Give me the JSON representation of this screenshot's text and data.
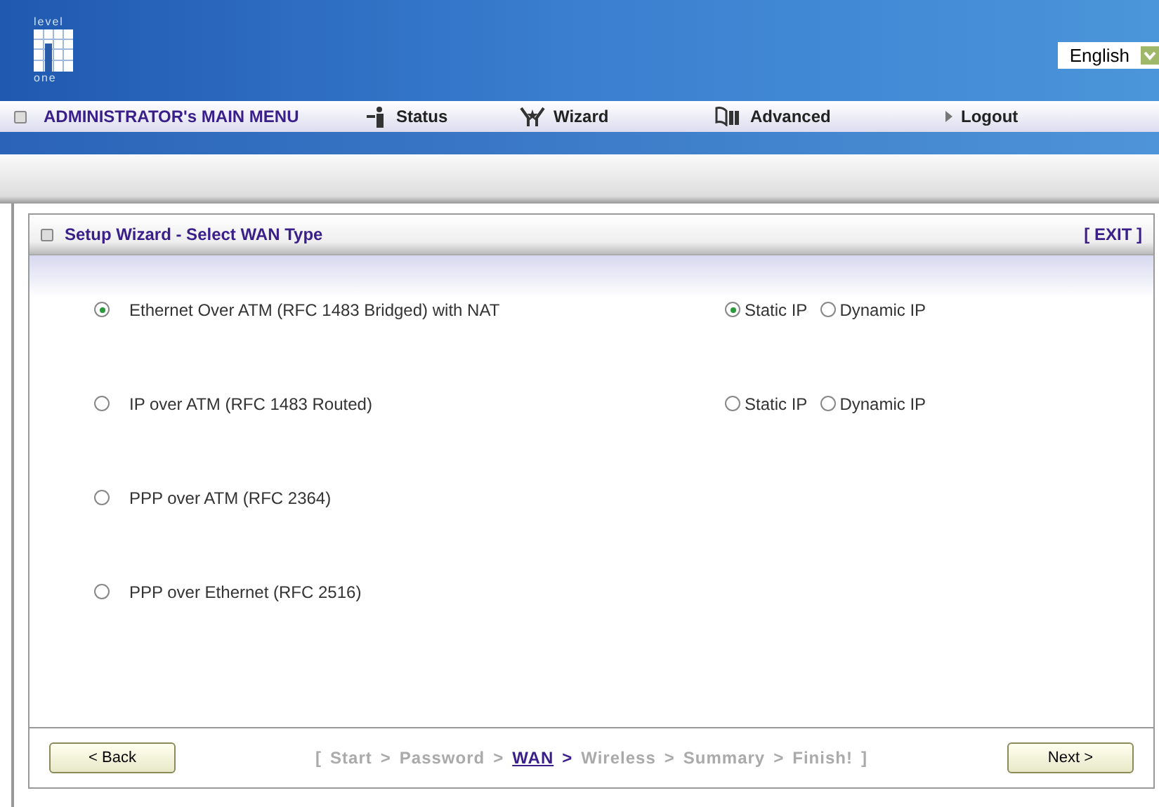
{
  "logo": {
    "top": "level",
    "bottom": "one"
  },
  "language": {
    "value": "English"
  },
  "menu": [
    {
      "label": "ADMINISTRATOR's MAIN MENU",
      "kind": "title"
    },
    {
      "label": "Status",
      "kind": "status"
    },
    {
      "label": "Wizard",
      "kind": "wizard"
    },
    {
      "label": "Advanced",
      "kind": "advanced"
    },
    {
      "label": "Logout",
      "kind": "logout"
    }
  ],
  "panel": {
    "title": "Setup Wizard - Select WAN Type",
    "exit": "[ EXIT ]"
  },
  "wan_types": [
    {
      "label": "Ethernet Over ATM (RFC 1483 Bridged) with NAT",
      "selected": true,
      "ip_options": [
        {
          "label": "Static IP",
          "selected": true
        },
        {
          "label": "Dynamic IP",
          "selected": false
        }
      ]
    },
    {
      "label": "IP over ATM (RFC 1483 Routed)",
      "selected": false,
      "ip_options": [
        {
          "label": "Static IP",
          "selected": false
        },
        {
          "label": "Dynamic IP",
          "selected": false
        }
      ]
    },
    {
      "label": "PPP over ATM (RFC 2364)",
      "selected": false
    },
    {
      "label": "PPP over Ethernet (RFC 2516)",
      "selected": false
    }
  ],
  "back_button": "< Back",
  "next_button": "Next >",
  "breadcrumb": [
    {
      "text": "[",
      "kind": "text",
      "highlighted": false
    },
    {
      "text": "Start",
      "kind": "text",
      "highlighted": false
    },
    {
      "text": ">",
      "kind": "text",
      "highlighted": false
    },
    {
      "text": "Password",
      "kind": "text",
      "highlighted": false
    },
    {
      "text": ">",
      "kind": "text",
      "highlighted": false
    },
    {
      "text": "WAN",
      "kind": "link",
      "highlighted": true
    },
    {
      "text": ">",
      "kind": "text",
      "highlighted": true
    },
    {
      "text": "Wireless",
      "kind": "text",
      "highlighted": false
    },
    {
      "text": ">",
      "kind": "text",
      "highlighted": false
    },
    {
      "text": "Summary",
      "kind": "text",
      "highlighted": false
    },
    {
      "text": ">",
      "kind": "text",
      "highlighted": false
    },
    {
      "text": "Finish!",
      "kind": "text",
      "highlighted": false
    },
    {
      "text": "]",
      "kind": "text",
      "highlighted": false
    }
  ]
}
